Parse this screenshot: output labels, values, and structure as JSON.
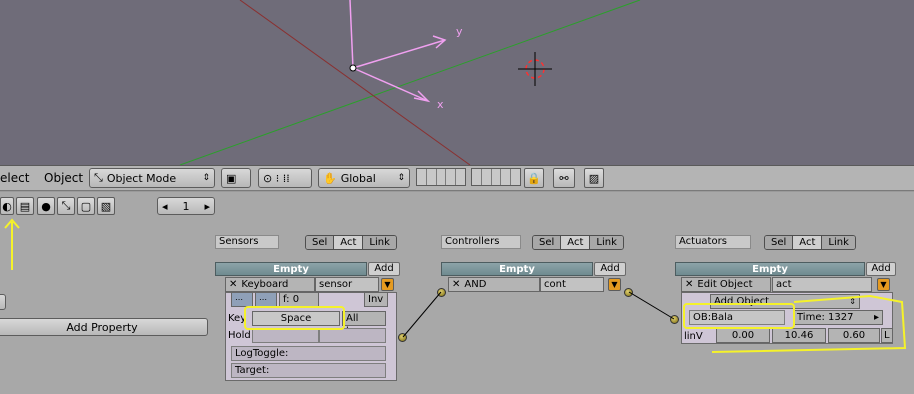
{
  "viewport": {
    "axis_y_label": "y",
    "axis_x_label": "x"
  },
  "header": {
    "select_menu": "elect",
    "object_menu": "Object",
    "mode_select": "Object Mode",
    "orientation": "Global"
  },
  "buttons_row": {
    "frame": "1"
  },
  "left": {
    "add_property": "Add Property"
  },
  "sensors": {
    "title": "Sensors",
    "toggles": [
      "Sel",
      "Act",
      "Link"
    ],
    "object": "Empty",
    "add": "Add",
    "type": "Keyboard",
    "name": "sensor",
    "freq": "f: 0",
    "inv": "Inv",
    "key_label": "Key",
    "key_value": "Space",
    "all_keys": "All keys",
    "hold_label": "Hold",
    "logtoggle": "LogToggle:",
    "target": "Target:"
  },
  "controllers": {
    "title": "Controllers",
    "toggles": [
      "Sel",
      "Act",
      "Link"
    ],
    "object": "Empty",
    "add": "Add",
    "type": "AND",
    "name": "cont"
  },
  "actuators": {
    "title": "Actuators",
    "toggles": [
      "Sel",
      "Act",
      "Link"
    ],
    "object": "Empty",
    "add": "Add",
    "type": "Edit Object",
    "name": "act",
    "mode": "Add Object",
    "ob": "OB:Bala",
    "time": "Time: 1327",
    "linv_label": "linV",
    "linv": [
      "0.00",
      "10.46",
      "0.60"
    ],
    "local": "L"
  }
}
